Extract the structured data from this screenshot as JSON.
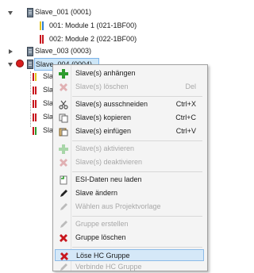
{
  "tree": {
    "nodes": [
      {
        "label": "Slave_001 (0001)"
      },
      {
        "label": "001: Module 1 (021-1BF00)"
      },
      {
        "label": "002: Module 2 (022-1BF00)"
      },
      {
        "label": "Slave_003 (0003)"
      },
      {
        "label": "Slave_004 (0004)"
      }
    ],
    "children_prefix": "Sla"
  },
  "context_menu": {
    "items": [
      {
        "label": "Slave(s) anhängen",
        "shortcut": "",
        "icon": "plus-icon",
        "enabled": true
      },
      {
        "label": "Slave(s) löschen",
        "shortcut": "Del",
        "icon": "delete-x-icon",
        "enabled": false
      },
      {
        "label": "Slave(s) ausschneiden",
        "shortcut": "Ctrl+X",
        "icon": "scissors-icon",
        "enabled": true
      },
      {
        "label": "Slave(s) kopieren",
        "shortcut": "Ctrl+C",
        "icon": "copy-icon",
        "enabled": true
      },
      {
        "label": "Slave(s) einfügen",
        "shortcut": "Ctrl+V",
        "icon": "paste-icon",
        "enabled": true
      },
      {
        "label": "Slave(s) aktivieren",
        "shortcut": "",
        "icon": "activate-plus-icon",
        "enabled": false
      },
      {
        "label": "Slave(s) deaktivieren",
        "shortcut": "",
        "icon": "deactivate-x-icon",
        "enabled": false
      },
      {
        "label": "ESI-Daten neu laden",
        "shortcut": "",
        "icon": "reload-document-icon",
        "enabled": true
      },
      {
        "label": "Slave ändern",
        "shortcut": "",
        "icon": "pencil-icon",
        "enabled": true
      },
      {
        "label": "Wählen aus Projektvorlage",
        "shortcut": "",
        "icon": "pencil-icon",
        "enabled": false
      },
      {
        "label": "Gruppe erstellen",
        "shortcut": "",
        "icon": "pencil-icon",
        "enabled": false
      },
      {
        "label": "Gruppe löschen",
        "shortcut": "",
        "icon": "delete-x-icon",
        "enabled": true
      },
      {
        "label": "Löse HC Gruppe",
        "shortcut": "",
        "icon": "delete-x-icon",
        "enabled": true,
        "highlighted": true
      },
      {
        "label": "Verbinde HC Gruppe",
        "shortcut": "",
        "icon": "pencil-icon",
        "enabled": false
      }
    ]
  },
  "colors": {
    "selection": "#cde6f7",
    "menu_background": "#f4f4f4",
    "highlight": "#d5e8f8",
    "add_green": "#2e9b2e",
    "delete_red": "#c8171e"
  }
}
